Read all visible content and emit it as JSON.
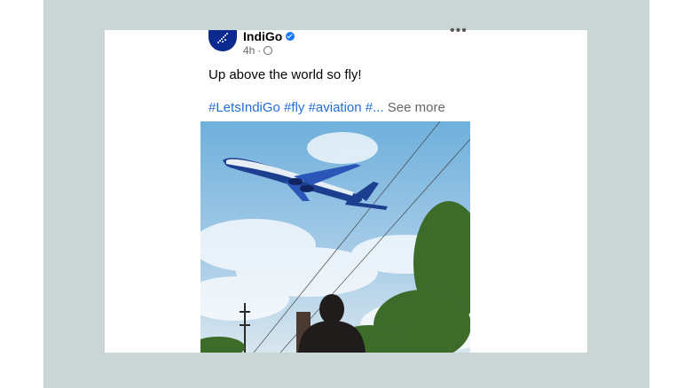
{
  "post": {
    "author": "IndiGo",
    "time": "4h",
    "separator": "·",
    "more_label": "•••",
    "caption": "Up above the world so fly!",
    "hashtags": "#LetsIndiGo #fly #aviation #...",
    "see_more": "See more"
  },
  "colors": {
    "brand": "#0b2a8f",
    "link": "#216fdb",
    "verified": "#1877f2",
    "frame": "#c9d6d5"
  },
  "icons": [
    "indigo-logo-icon",
    "verified-badge-icon",
    "globe-icon",
    "more-options-icon"
  ]
}
